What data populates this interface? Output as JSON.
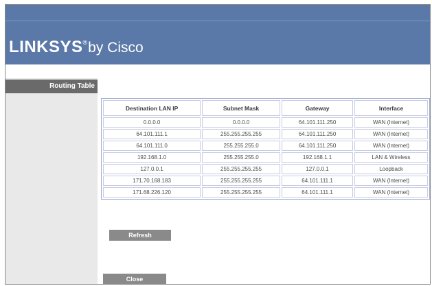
{
  "header": {
    "brand": "LINKSYS",
    "registered": "®",
    "byline": "by Cisco"
  },
  "sidebar": {
    "section_title": "Routing Table"
  },
  "table": {
    "columns": [
      "Destination LAN IP",
      "Subnet Mask",
      "Gateway",
      "Interface"
    ],
    "rows": [
      [
        "0.0.0.0",
        "0.0.0.0",
        "64.101.111.250",
        "WAN (Internet)"
      ],
      [
        "64.101.111.1",
        "255.255.255.255",
        "64.101.111.250",
        "WAN (Internet)"
      ],
      [
        "64.101.111.0",
        "255.255.255.0",
        "64.101.111.250",
        "WAN (Internet)"
      ],
      [
        "192.168.1.0",
        "255.255.255.0",
        "192.168.1.1",
        "LAN & Wireless"
      ],
      [
        "127.0.0.1",
        "255.255.255.255",
        "127.0.0.1",
        "Loopback"
      ],
      [
        "171.70.168.183",
        "255.255.255.255",
        "64.101.111.1",
        "WAN (Internet)"
      ],
      [
        "171.68.226.120",
        "255.255.255.255",
        "64.101.111.1",
        "WAN (Internet)"
      ]
    ]
  },
  "buttons": {
    "refresh": "Refresh",
    "close": "Close"
  },
  "colors": {
    "header_blue": "#5b79a8",
    "sidebar_gray": "#e9e9e9",
    "button_gray": "#8a8a8a"
  }
}
